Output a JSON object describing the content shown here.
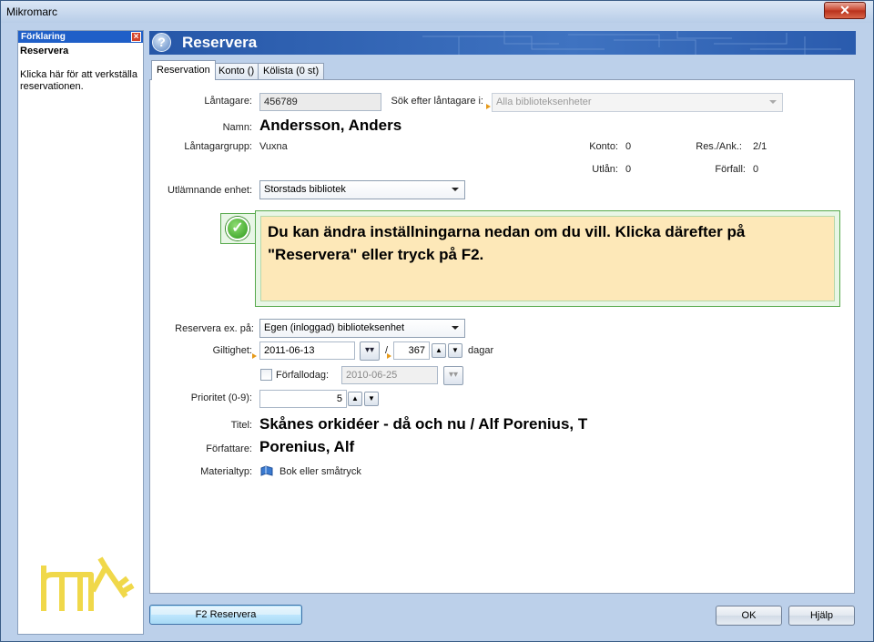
{
  "window": {
    "title": "Mikromarc",
    "close_symbol": "✕"
  },
  "left_panel": {
    "header": "Förklaring",
    "title": "Reservera",
    "text": "Klicka här för att verkställa reservationen."
  },
  "header": {
    "title": "Reservera",
    "help_symbol": "?"
  },
  "tabs": [
    {
      "label": "Reservation",
      "active": true
    },
    {
      "label": "Konto ()"
    },
    {
      "label": "Kölista (0 st)"
    }
  ],
  "form": {
    "borrower_label": "Låntagare:",
    "borrower_value": "456789",
    "search_label": "Sök efter låntagare i:",
    "search_value": "Alla biblioteksenheter",
    "name_label": "Namn:",
    "name_value": "Andersson, Anders",
    "group_label": "Låntagargrupp:",
    "group_value": "Vuxna",
    "konto_label": "Konto:",
    "konto_value": "0",
    "resank_label": "Res./Ank.:",
    "resank_value": "2/1",
    "utlan_label": "Utlån:",
    "utlan_value": "0",
    "forfall_label": "Förfall:",
    "forfall_value": "0",
    "unit_label": "Utlämnande enhet:",
    "unit_value": "Storstads bibliotek"
  },
  "info_message": "Du kan ändra inställningarna nedan om du vill. Klicka därefter på \"Reservera\" eller tryck på F2.",
  "options": {
    "reserve_on_label": "Reservera ex. på:",
    "reserve_on_value": "Egen (inloggad) biblioteksenhet",
    "validity_label": "Giltighet:",
    "validity_date": "2011-06-13",
    "validity_sep": "/",
    "validity_days": "367",
    "days_label": "dagar",
    "dueday_label": "Förfallodag:",
    "dueday_value": "2010-06-25",
    "priority_label": "Prioritet (0-9):",
    "priority_value": "5"
  },
  "item": {
    "title_label": "Titel:",
    "title_value": "Skånes orkidéer - då och nu / Alf Porenius, T",
    "author_label": "Författare:",
    "author_value": "Porenius, Alf",
    "material_label": "Materialtyp:",
    "material_value": "Bok eller småtryck"
  },
  "buttons": {
    "reserve": "F2 Reservera",
    "ok": "OK",
    "help": "Hjälp"
  },
  "icons": [
    "help-icon",
    "check-icon",
    "book-icon",
    "chevron-down-icon",
    "spin-up-icon",
    "spin-down-icon",
    "close-icon",
    "logo-icon"
  ],
  "colors": {
    "accent": "#2657a8",
    "info_bg": "#fde8b8",
    "info_border": "#57a94c"
  }
}
